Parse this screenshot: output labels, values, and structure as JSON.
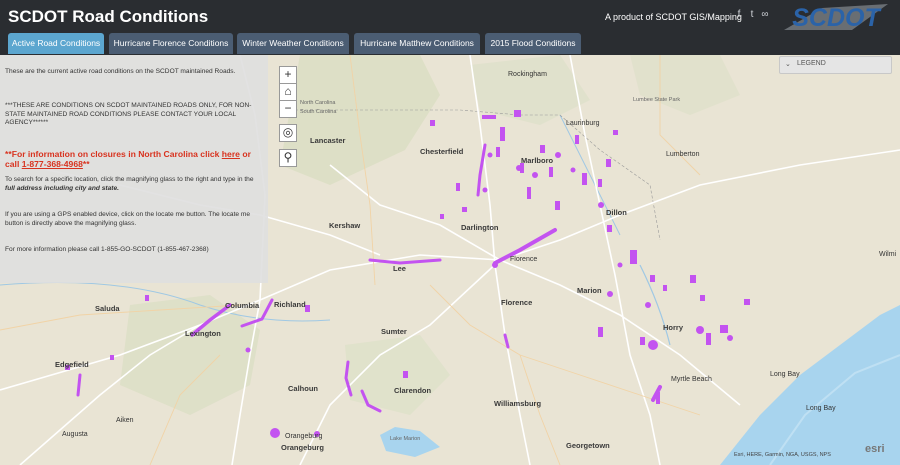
{
  "header": {
    "title": "SCDOT Road Conditions",
    "product_text": "A product of SCDOT GIS/Mapping",
    "logo_text": "SCDOT",
    "social_icons": [
      "facebook-icon",
      "twitter-icon",
      "link-icon"
    ]
  },
  "tabs": [
    {
      "label": "Active Road Conditions",
      "active": true
    },
    {
      "label": "Hurricane Florence Conditions",
      "active": false
    },
    {
      "label": "Winter Weather Conditions",
      "active": false
    },
    {
      "label": "Hurricane Matthew Conditions",
      "active": false
    },
    {
      "label": "2015 Flood Conditions",
      "active": false
    }
  ],
  "info": {
    "p1": "These are the current active road conditions on the SCDOT maintained Roads.",
    "p2": "***THESE ARE CONDITIONS ON SCDOT MAINTAINED ROADS ONLY, FOR NON-STATE MAINTAINED ROAD CONDITIONS PLEASE CONTACT YOUR LOCAL AGENCY******",
    "nc_prefix": "**For information on closures in North Carolina click ",
    "nc_link": "here",
    "nc_mid": " or call ",
    "nc_phone": "1-877-368-4968",
    "nc_suffix": "**",
    "search_help_1": "To search for a specific location, click the magnifying glass to the right and type in the ",
    "search_help_2": "full address including city and state.",
    "gps_help": "If you are using a GPS enabled device, click on the locate me button. The locate me button is directly above the magnifying glass.",
    "phone_help": "For more information please call 1-855-GO-SCDOT (1-855-467-2368)"
  },
  "map_controls": {
    "zoom_in": "+",
    "home": "⌂",
    "zoom_out": "−",
    "locate": "◎",
    "search": "⚲"
  },
  "legend": {
    "label": "LEGEND"
  },
  "places": {
    "rockingham": "Rockingham",
    "laurinburg": "Laurinburg",
    "lumberton": "Lumberton",
    "lumbee": "Lumbee State Park",
    "north_carolina": "North Carolina",
    "south_carolina": "South Carolina",
    "lancaster": "Lancaster",
    "chesterfield": "Chesterfield",
    "marlboro": "Marlboro",
    "dillon": "Dillon",
    "kershaw": "Kershaw",
    "darlington": "Darlington",
    "lee": "Lee",
    "florence_city": "Florence",
    "florence": "Florence",
    "marion": "Marion",
    "saluda": "Saluda",
    "columbia": "Columbia",
    "richland": "Richland",
    "lexington": "Lexington",
    "sumter": "Sumter",
    "horry": "Horry",
    "edgefield": "Edgefield",
    "calhoun": "Calhoun",
    "clarendon": "Clarendon",
    "williamsburg": "Williamsburg",
    "myrtle_beach": "Myrtle Beach",
    "long_bay_1": "Long Bay",
    "long_bay_2": "Long Bay",
    "aiken": "Aiken",
    "augusta": "Augusta",
    "orangeburg_1": "Orangeburg",
    "orangeburg_2": "Orangeburg",
    "lake_marion": "Lake Marion",
    "georgetown": "Georgetown",
    "wilmington": "Wilmi"
  },
  "attribution": "Esri, HERE, Garmin, NGA, USGS, NPS",
  "esri_logo": "esri",
  "colors": {
    "header": "#2a2d31",
    "tab_active": "#5ca6cf",
    "tab_inactive": "#4b5d73",
    "road_condition": "#c353f0",
    "water": "#a8d4ee",
    "map_land": "#e9e4d4",
    "logo": "#2b63a8"
  }
}
